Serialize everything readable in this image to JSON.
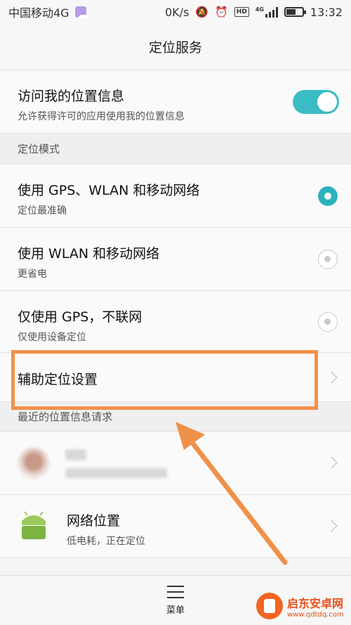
{
  "status_bar": {
    "carrier": "中国移动4G",
    "speed": "0K/s",
    "network": "4G",
    "hd_badge": "HD",
    "time": "13:32",
    "battery_level": 0.6
  },
  "header": {
    "title": "定位服务"
  },
  "location_access": {
    "title": "访问我的位置信息",
    "subtitle": "允许获得许可的应用使用我的位置信息",
    "enabled": true
  },
  "mode_section": {
    "header": "定位模式",
    "options": [
      {
        "label": "使用 GPS、WLAN 和移动网络",
        "desc": "定位最准确",
        "selected": true
      },
      {
        "label": "使用 WLAN 和移动网络",
        "desc": "更省电",
        "selected": false
      },
      {
        "label": "仅使用 GPS，不联网",
        "desc": "仅使用设备定位",
        "selected": false
      }
    ]
  },
  "assist_settings": {
    "label": "辅助定位设置"
  },
  "recent_section": {
    "header": "最近的位置信息请求",
    "items": [
      {
        "name": "",
        "detail": "",
        "blurred": true,
        "icon": "blurred-app-icon"
      },
      {
        "name": "网络位置",
        "detail": "低电耗，正在定位",
        "blurred": false,
        "icon": "android-icon"
      }
    ]
  },
  "bottom_bar": {
    "menu_label": "菜单"
  },
  "watermark": {
    "title": "启东安卓网",
    "url": "www.qdtdq.com"
  },
  "colors": {
    "accent": "#2bb2bd",
    "annotation": "#f0914a"
  }
}
